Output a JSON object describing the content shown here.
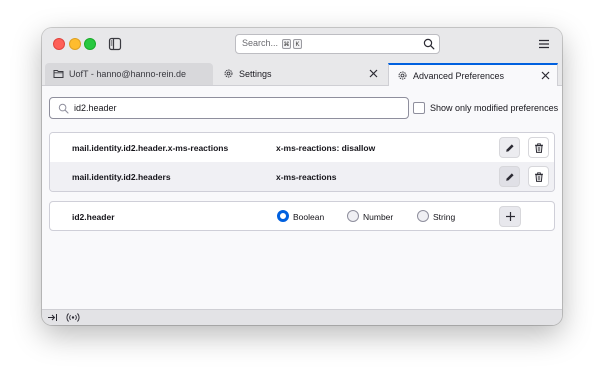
{
  "search": {
    "placeholder": "Search...",
    "shortcut_keys": [
      "⌘",
      "K"
    ]
  },
  "tabs": [
    {
      "label": "UofT - hanno@hanno-rein.de",
      "icon": "folder-icon"
    },
    {
      "label": "Settings",
      "icon": "gear-icon"
    },
    {
      "label": "Advanced Preferences",
      "icon": "gear-icon",
      "active": true
    }
  ],
  "filter": {
    "value": "id2.header",
    "checkbox_label": "Show only modified preferences",
    "checked": false
  },
  "preferences": [
    {
      "name": "mail.identity.id2.header.x-ms-reactions",
      "value": "x-ms-reactions: disallow"
    },
    {
      "name": "mail.identity.id2.headers",
      "value": "x-ms-reactions"
    }
  ],
  "new_pref": {
    "name": "id2.header",
    "types": [
      {
        "label": "Boolean",
        "selected": true
      },
      {
        "label": "Number",
        "selected": false
      },
      {
        "label": "String",
        "selected": false
      }
    ]
  },
  "colors": {
    "accent": "#0060df",
    "titlebar": "#e8e8ea"
  }
}
